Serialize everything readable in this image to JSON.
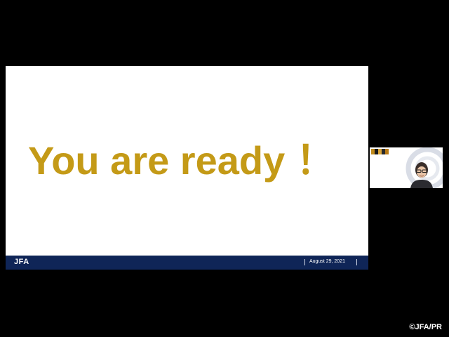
{
  "slide": {
    "headline": "You are ready ！",
    "footer": {
      "logo": "JFA",
      "date": "August 29, 2021"
    }
  },
  "participant": {
    "camera_icon": "person-video-icon"
  },
  "copyright": "©JFA/PR",
  "colors": {
    "headline": "#c49a17",
    "footer_bar": "#0f2557",
    "background": "#000000"
  }
}
